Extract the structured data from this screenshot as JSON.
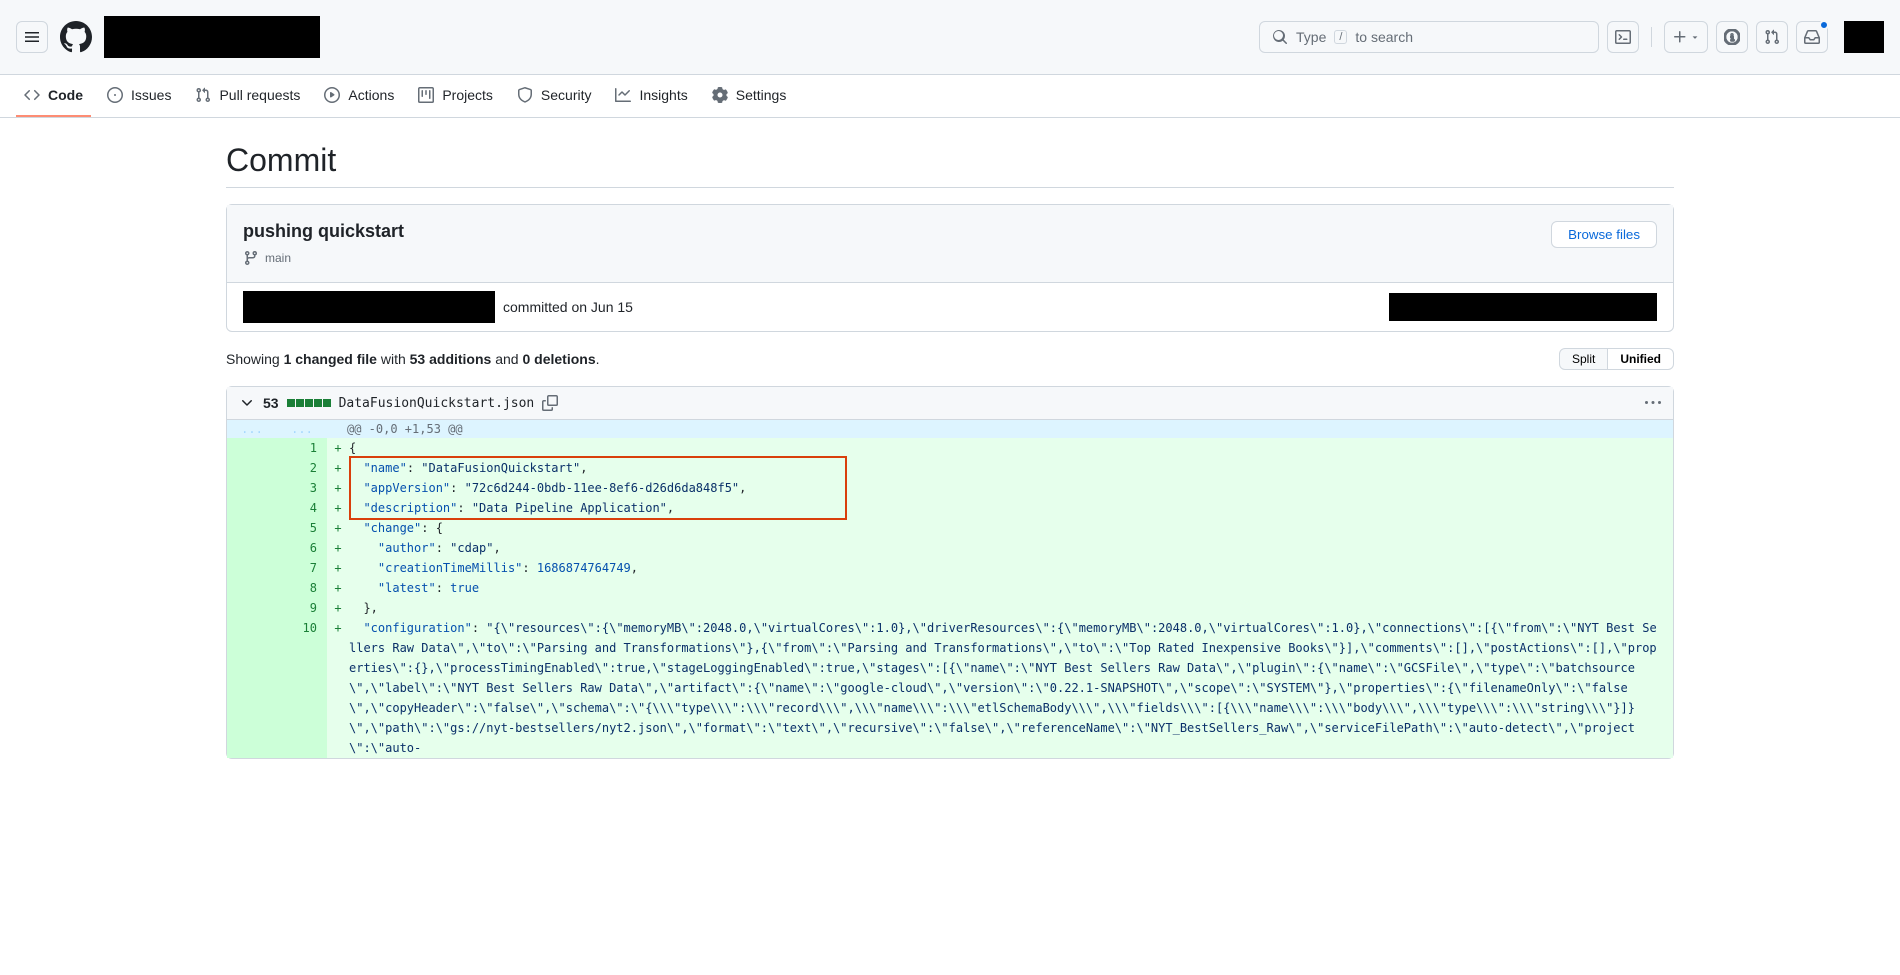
{
  "header": {
    "search_placeholder_prefix": "Type ",
    "search_kbd": "/",
    "search_placeholder_suffix": " to search"
  },
  "repo_nav": {
    "code": "Code",
    "issues": "Issues",
    "pulls": "Pull requests",
    "actions": "Actions",
    "projects": "Projects",
    "security": "Security",
    "insights": "Insights",
    "settings": "Settings"
  },
  "page": {
    "title": "Commit"
  },
  "commit": {
    "title": "pushing quickstart",
    "branch": "main",
    "browse_files": "Browse files",
    "committed_text": "committed on Jun 15"
  },
  "summary": {
    "prefix": "Showing ",
    "changed_file": "1 changed file",
    "with": " with ",
    "additions": "53 additions",
    "and": " and ",
    "deletions": "0 deletions",
    "suffix": "."
  },
  "view_toggle": {
    "split": "Split",
    "unified": "Unified"
  },
  "file": {
    "changes_count": "53",
    "filename": "DataFusionQuickstart.json",
    "hunk": "@@ -0,0 +1,53 @@"
  },
  "diff_lines": [
    {
      "num": "1",
      "content_html": "{"
    },
    {
      "num": "2",
      "content_html": "  <span class=\"tok-key\">\"name\"</span>: <span class=\"tok-str\">\"DataFusionQuickstart\"</span>,"
    },
    {
      "num": "3",
      "content_html": "  <span class=\"tok-key\">\"appVersion\"</span>: <span class=\"tok-str\">\"72c6d244-0bdb-11ee-8ef6-d26d6da848f5\"</span>,"
    },
    {
      "num": "4",
      "content_html": "  <span class=\"tok-key\">\"description\"</span>: <span class=\"tok-str\">\"Data Pipeline Application\"</span>,"
    },
    {
      "num": "5",
      "content_html": "  <span class=\"tok-key\">\"change\"</span>: {"
    },
    {
      "num": "6",
      "content_html": "    <span class=\"tok-key\">\"author\"</span>: <span class=\"tok-str\">\"cdap\"</span>,"
    },
    {
      "num": "7",
      "content_html": "    <span class=\"tok-key\">\"creationTimeMillis\"</span>: <span class=\"tok-num\">1686874764749</span>,"
    },
    {
      "num": "8",
      "content_html": "    <span class=\"tok-key\">\"latest\"</span>: <span class=\"tok-bool\">true</span>"
    },
    {
      "num": "9",
      "content_html": "  },"
    },
    {
      "num": "10",
      "content_html": "  <span class=\"tok-key\">\"configuration\"</span>: <span class=\"tok-str\">\"{\\\"resources\\\":{\\\"memoryMB\\\":2048.0,\\\"virtualCores\\\":1.0},\\\"driverResources\\\":{\\\"memoryMB\\\":2048.0,\\\"virtualCores\\\":1.0},\\\"connections\\\":[{\\\"from\\\":\\\"NYT Best Sellers Raw Data\\\",\\\"to\\\":\\\"Parsing and Transformations\\\"},{\\\"from\\\":\\\"Parsing and Transformations\\\",\\\"to\\\":\\\"Top Rated Inexpensive Books\\\"}],\\\"comments\\\":[],\\\"postActions\\\":[],\\\"properties\\\":{},\\\"processTimingEnabled\\\":true,\\\"stageLoggingEnabled\\\":true,\\\"stages\\\":[{\\\"name\\\":\\\"NYT Best Sellers Raw Data\\\",\\\"plugin\\\":{\\\"name\\\":\\\"GCSFile\\\",\\\"type\\\":\\\"batchsource\\\",\\\"label\\\":\\\"NYT Best Sellers Raw Data\\\",\\\"artifact\\\":{\\\"name\\\":\\\"google-cloud\\\",\\\"version\\\":\\\"0.22.1-SNAPSHOT\\\",\\\"scope\\\":\\\"SYSTEM\\\"},\\\"properties\\\":{\\\"filenameOnly\\\":\\\"false\\\",\\\"copyHeader\\\":\\\"false\\\",\\\"schema\\\":\\\"{\\\\\\\"type\\\\\\\":\\\\\\\"record\\\\\\\",\\\\\\\"name\\\\\\\":\\\\\\\"etlSchemaBody\\\\\\\",\\\\\\\"fields\\\\\\\":[{\\\\\\\"name\\\\\\\":\\\\\\\"body\\\\\\\",\\\\\\\"type\\\\\\\":\\\\\\\"string\\\\\\\"}]}\\\",\\\"path\\\":\\\"gs://nyt-bestsellers/nyt2.json\\\",\\\"format\\\":\\\"text\\\",\\\"recursive\\\":\\\"false\\\",\\\"referenceName\\\":\\\"NYT_BestSellers_Raw\\\",\\\"serviceFilePath\\\":\\\"auto-detect\\\",\\\"project\\\":\\\"auto-</span>"
    }
  ]
}
